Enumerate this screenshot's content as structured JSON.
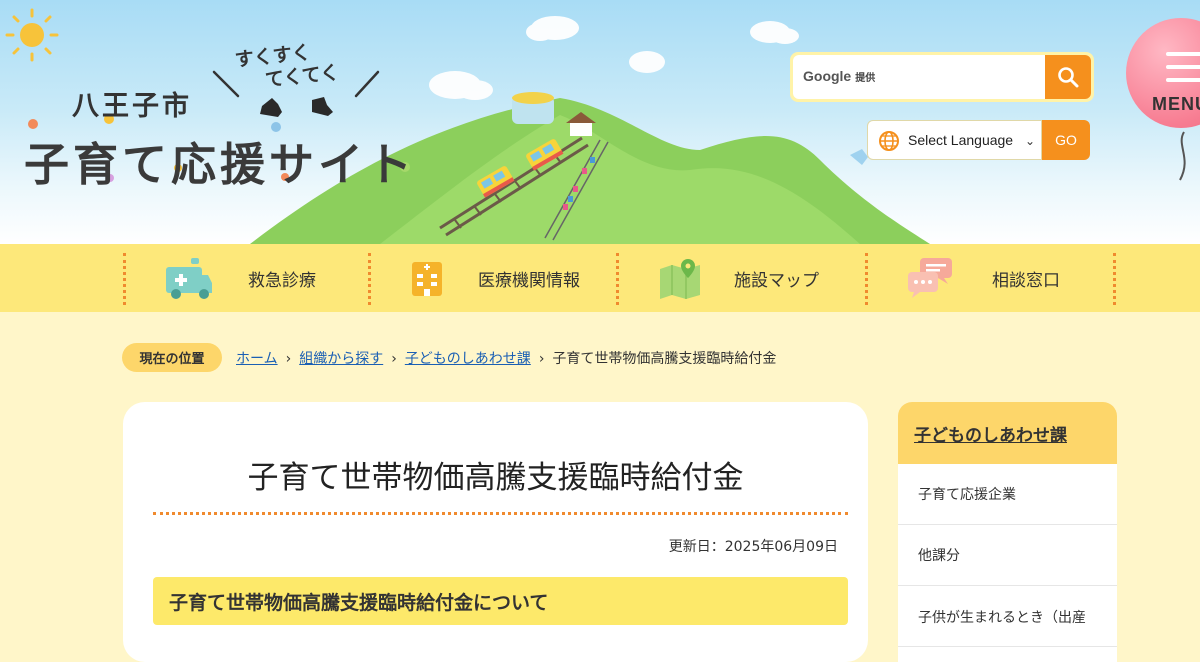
{
  "header": {
    "city": "八王子市",
    "tagline_line1": "すくすく",
    "tagline_line2": "てくてく",
    "site_title": "子育て応援サイト",
    "search": {
      "brand": "Google",
      "brand_note": "提供",
      "placeholder": ""
    },
    "language": {
      "selected": "Select Language",
      "go_label": "GO"
    },
    "menu_label": "MENU"
  },
  "nav": {
    "items": [
      {
        "label": "救急診療",
        "icon": "ambulance-icon"
      },
      {
        "label": "医療機関情報",
        "icon": "hospital-icon"
      },
      {
        "label": "施設マップ",
        "icon": "map-icon"
      },
      {
        "label": "相談窓口",
        "icon": "chat-icon"
      }
    ]
  },
  "breadcrumb": {
    "badge": "現在の位置",
    "links": [
      "ホーム",
      "組織から探す",
      "子どものしあわせ課"
    ],
    "current": "子育て世帯物価高騰支援臨時給付金"
  },
  "main": {
    "title": "子育て世帯物価高騰支援臨時給付金",
    "updated": "更新日：2025年06月09日",
    "section_heading": "子育て世帯物価高騰支援臨時給付金について"
  },
  "sidebar": {
    "heading": "子どものしあわせ課",
    "items": [
      {
        "label": "子育て応援企業"
      },
      {
        "label": "他課分"
      },
      {
        "label": "子供が生まれるとき（出産"
      }
    ]
  },
  "colors": {
    "accent_orange": "#f5901d",
    "nav_yellow": "#fde87a",
    "page_bg": "#fff6c9",
    "link_blue": "#1a5fb4",
    "balloon_pink": "#f77d92"
  }
}
